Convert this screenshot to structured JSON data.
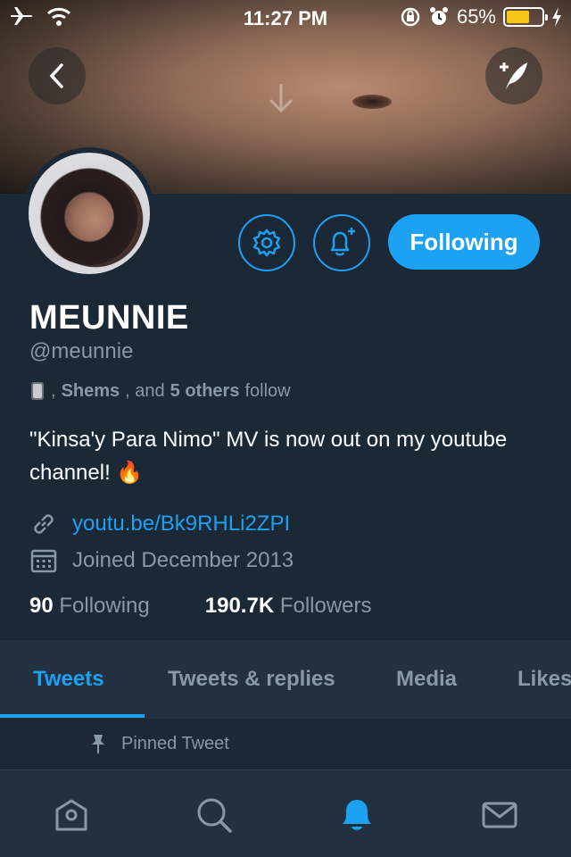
{
  "status_bar": {
    "time": "11:27 PM",
    "battery": "65%",
    "battery_level": 0.65
  },
  "profile": {
    "name": "MEUNNIE",
    "handle": "@meunnie",
    "followed_by": {
      "comma": ",",
      "name": "Shems",
      "middle": ", and",
      "others": "5 others",
      "suffix": "follow"
    },
    "bio": "\"Kinsa'y Para Nimo\" MV is now out on my youtube channel! 🔥",
    "link": "youtu.be/Bk9RHLi2ZPI",
    "joined": "Joined December 2013",
    "following_count": "90",
    "following_label": "Following",
    "followers_count": "190.7K",
    "followers_label": "Followers"
  },
  "actions": {
    "follow_button": "Following"
  },
  "tabs": [
    {
      "label": "Tweets",
      "active": true
    },
    {
      "label": "Tweets & replies",
      "active": false
    },
    {
      "label": "Media",
      "active": false
    },
    {
      "label": "Likes",
      "active": false
    }
  ],
  "pinned": {
    "label": "Pinned Tweet"
  },
  "colors": {
    "accent": "#1da1f2",
    "background": "#1b2836",
    "muted": "#8899a6"
  },
  "icons": [
    "airplane-icon",
    "wifi-icon",
    "orientation-lock-icon",
    "alarm-icon",
    "charging-icon",
    "back-icon",
    "compose-tweet-icon",
    "settings-icon",
    "add-notification-icon",
    "link-icon",
    "calendar-icon",
    "pin-icon",
    "home-icon",
    "search-icon",
    "notifications-icon",
    "messages-icon"
  ]
}
